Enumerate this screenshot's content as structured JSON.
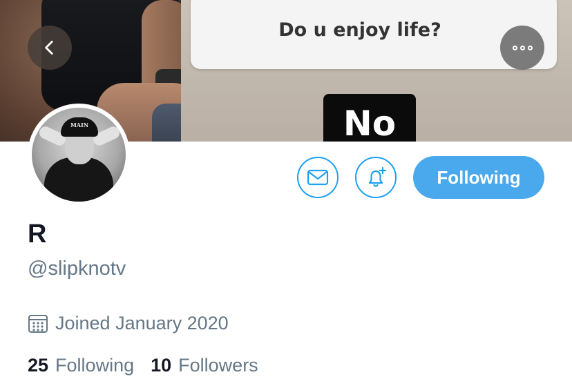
{
  "banner": {
    "speech_text": "Do u enjoy life?",
    "sign_text": "No"
  },
  "navigation": {
    "back_icon": "chevron-left-icon",
    "more_icon": "more-options-icon"
  },
  "avatar": {
    "cap_text": "MAIN"
  },
  "actions": {
    "message_icon": "mail-icon",
    "notifications_icon": "bell-plus-icon",
    "follow_label": "Following"
  },
  "profile": {
    "display_name": "R",
    "handle": "@slipknotv",
    "joined": "Joined January 2020",
    "following_count": "25",
    "following_label": "Following",
    "followers_count": "10",
    "followers_label": "Followers"
  },
  "colors": {
    "accent": "#1da1f2",
    "button_fill": "#4aa8ec",
    "secondary_text": "#657786",
    "primary_text": "#141823"
  }
}
